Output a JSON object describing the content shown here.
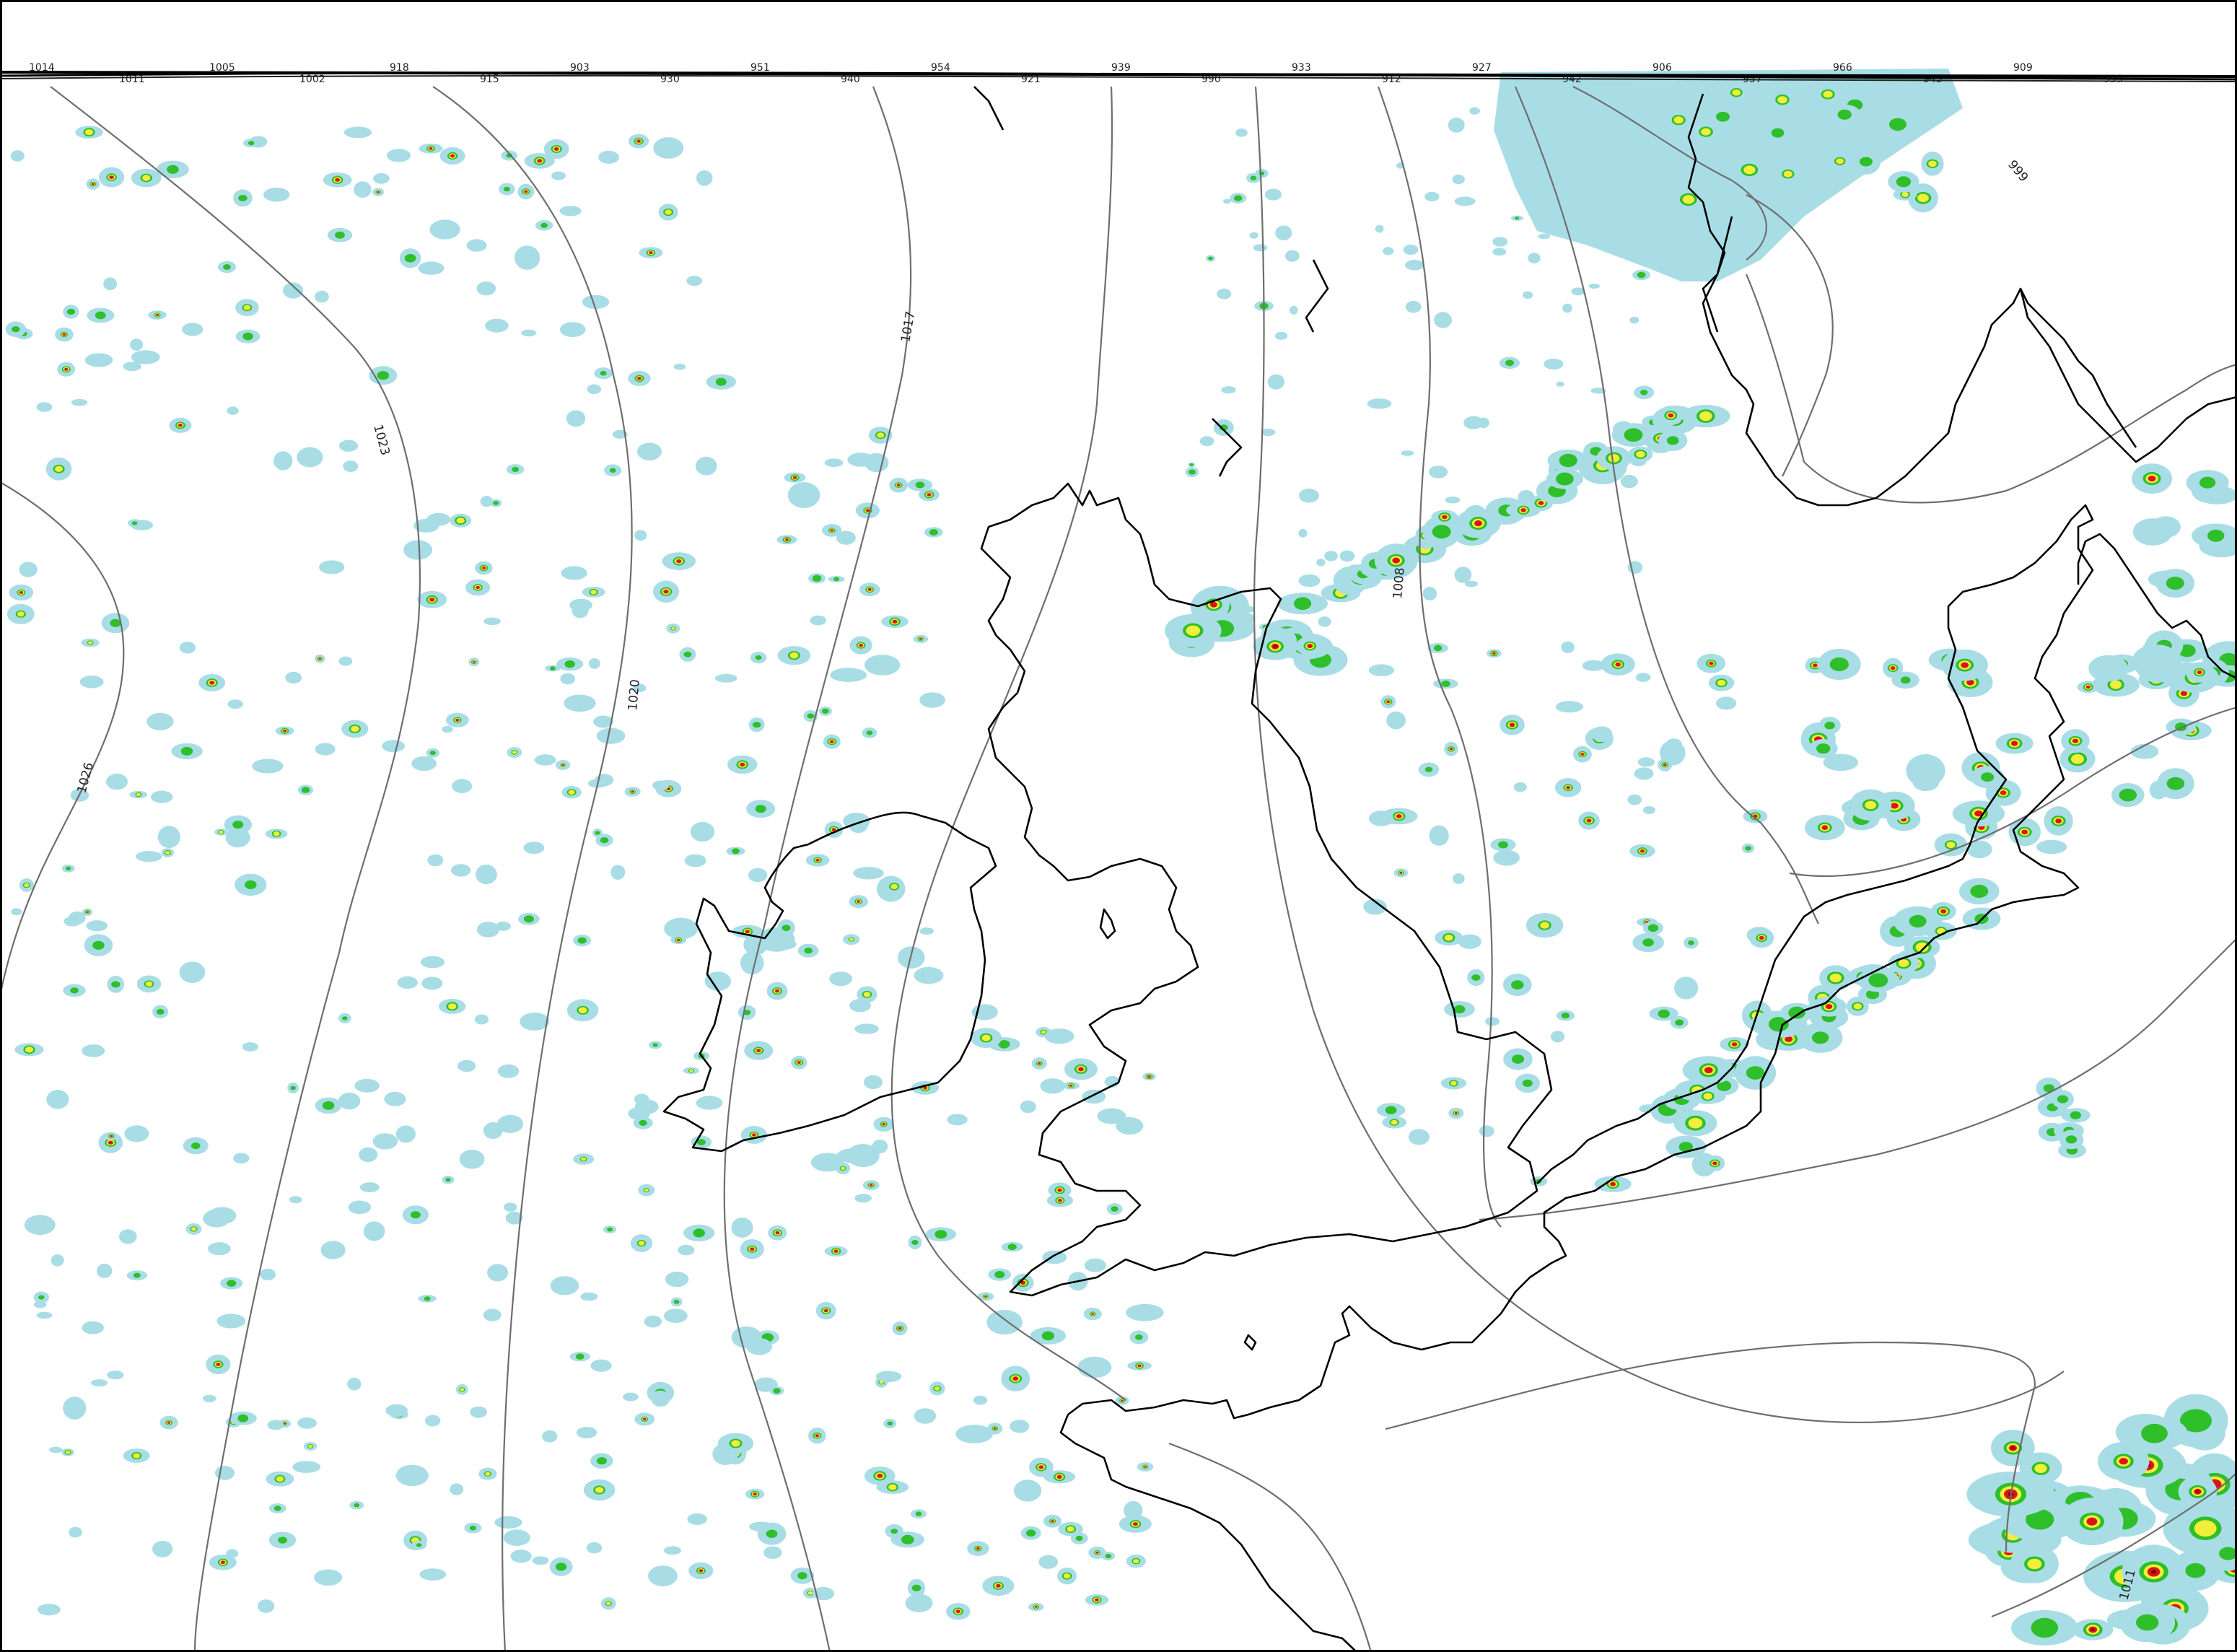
{
  "map": {
    "colors": {
      "light": "#a9dde6",
      "green": "#2fbf2a",
      "yellow": "#f2ee3a",
      "red": "#d91616",
      "dark": "#7a0b0b",
      "isobar": "#6e6e6e",
      "coast": "#000000"
    },
    "isobar_labels": [
      {
        "id": "1026",
        "text": "1026"
      },
      {
        "id": "1023",
        "text": "1023"
      },
      {
        "id": "1020",
        "text": "1020"
      },
      {
        "id": "1017",
        "text": "1017"
      },
      {
        "id": "1008",
        "text": "1008"
      },
      {
        "id": "999",
        "text": "999"
      },
      {
        "id": "1011",
        "text": "1011"
      }
    ],
    "top_labels": [
      "1014",
      "1011",
      "1005",
      "1002",
      "918",
      "915",
      "903",
      "930",
      "951",
      "940",
      "954",
      "921",
      "939",
      "990",
      "933",
      "912",
      "927",
      "942",
      "906",
      "957",
      "966",
      "945",
      "909",
      "999"
    ]
  }
}
